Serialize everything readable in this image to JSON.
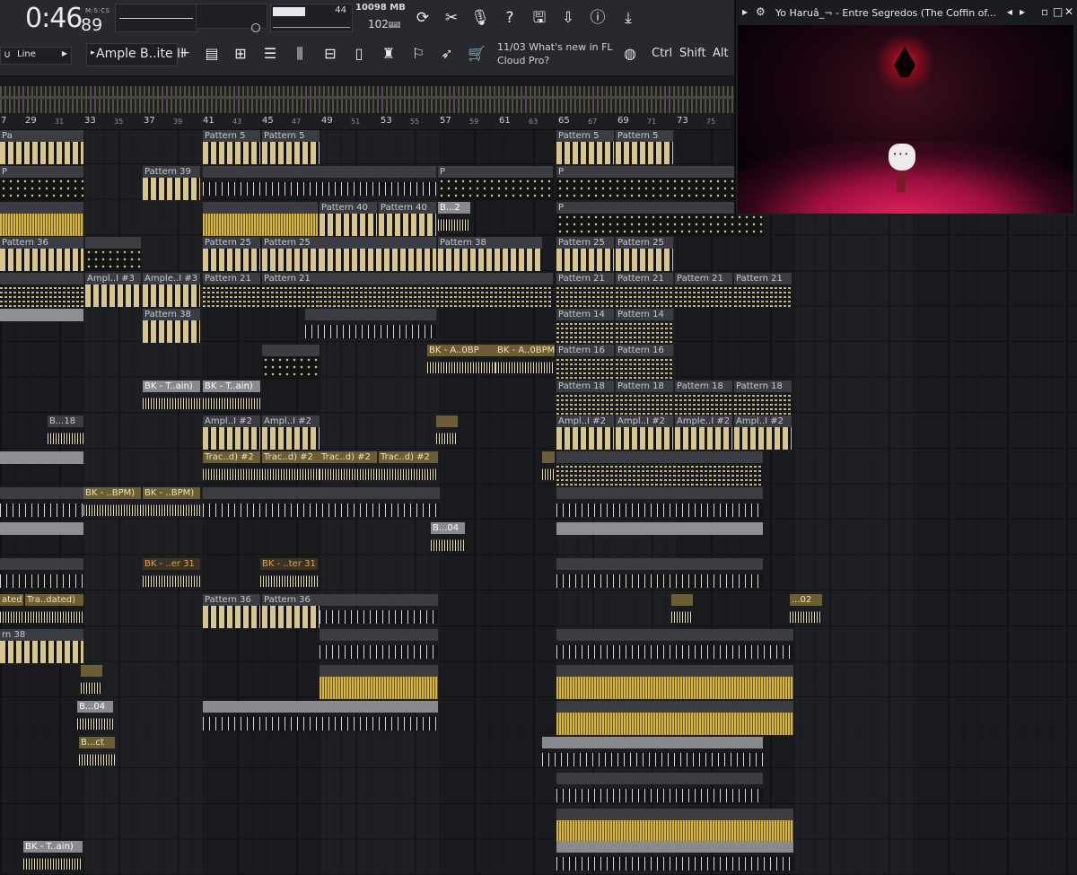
{
  "toolbar": {
    "time_main": "0:46",
    "time_sub": "89",
    "time_format": "M:S:CS",
    "cpu_value": "44",
    "memory": "10098 MB",
    "polyphony": "102",
    "polyphony_tag": "FPS",
    "snap_label": "Line",
    "instrument_label": "Ample B..ite II",
    "add_label": "+",
    "news_line1": "11/03  What's new in FL",
    "news_line2": "Cloud Pro?",
    "ctrl_label": "Ctrl",
    "shift_label": "Shift",
    "alt_label": "Alt"
  },
  "ruler": {
    "major": [
      "7",
      "29",
      "33",
      "37",
      "41",
      "45",
      "49",
      "53",
      "57",
      "61",
      "65",
      "69",
      "73"
    ],
    "minor": [
      "31",
      "35",
      "39",
      "43",
      "47",
      "51",
      "55",
      "59",
      "63",
      "67",
      "71",
      "75"
    ]
  },
  "clips": {
    "pattern5": "Pattern 5",
    "pattern39": "Pattern 39",
    "pattern40": "Pattern 40",
    "pattern36": "Pattern 36",
    "pattern25": "Pattern 25",
    "pattern38": "Pattern 38",
    "pattern21": "Pattern 21",
    "pattern14": "Pattern 14",
    "pattern16": "Pattern 16",
    "pattern18": "Pattern 18",
    "ampl_i3": "Ampl..I #3",
    "ample_i3": "Ample..I #3",
    "ampl_i2": "Ampl..I #2",
    "ample_i2": "Ample..I #2",
    "bk_tain": "BK - T..ain)",
    "bk_bpm": "BK - ..BPM)",
    "bk_aobp": "BK - A..0BP",
    "bk_a0bpm": "BK - A..0BPM)",
    "bk_er31": "BK - ..er 31",
    "bk_ter31": "BK - ..ter 31",
    "trac_d2": "Trac..d) #2",
    "tra_dated": "Tra..dated)",
    "ated": "ated)",
    "b_18": "B...18",
    "b_2": "B...2",
    "b_04": "B...04",
    "b_ct": "B...ct",
    "pa": "Pa",
    "p": "P",
    "row36_left": "36",
    "row38_left": "rn 38",
    "dotted_02": "...02"
  },
  "video": {
    "title": "Yo Haruâ_¬ - Entre Segredos (The Coffin of..."
  },
  "colors": {
    "background": "#18191c",
    "accent_gold": "#d6c58f",
    "clip_header": "#3b3d43",
    "video_glow": "#e5245e"
  }
}
